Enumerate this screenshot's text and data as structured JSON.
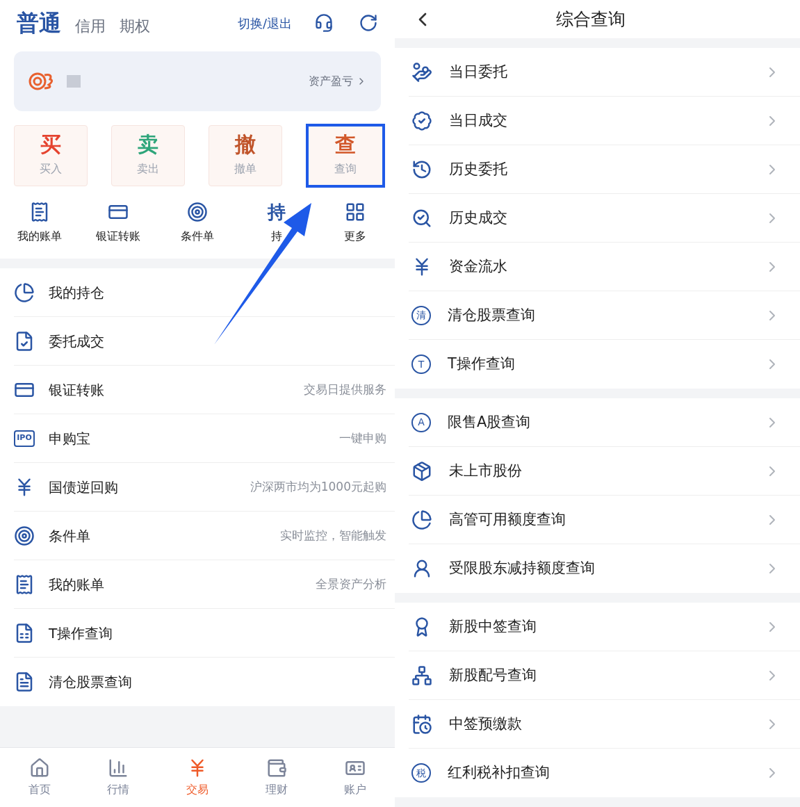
{
  "trade_screen": {
    "account_tabs": [
      {
        "label": "普通",
        "selected": true
      },
      {
        "label": "信用",
        "selected": false
      },
      {
        "label": "期权",
        "selected": false
      }
    ],
    "switch_link": "切换/退出",
    "account_card": {
      "link": "资产盈亏"
    },
    "trade_buttons": [
      {
        "glyph": "买",
        "label": "买入",
        "color": "#e5432f",
        "annotated": false
      },
      {
        "glyph": "卖",
        "label": "卖出",
        "color": "#2ea57a",
        "annotated": false
      },
      {
        "glyph": "撤",
        "label": "撤单",
        "color": "#c0542a",
        "annotated": false
      },
      {
        "glyph": "查",
        "label": "查询",
        "color": "#d2582a",
        "annotated": true
      }
    ],
    "shortcuts": [
      {
        "kind": "icon",
        "label": "我的账单"
      },
      {
        "kind": "icon",
        "label": "银证转账"
      },
      {
        "kind": "icon",
        "label": "条件单"
      },
      {
        "kind": "glyph",
        "glyph": "持",
        "label": "持"
      },
      {
        "kind": "icon",
        "label": "更多"
      }
    ],
    "menu": [
      {
        "label": "我的持仓"
      },
      {
        "label": "委托成交"
      },
      {
        "label": "银证转账",
        "hint": "交易日提供服务"
      },
      {
        "label": "申购宝",
        "badge": "IPO",
        "hint": "一键申购"
      },
      {
        "label": "国债逆回购",
        "hint": "沪深两市均为1000元起购"
      },
      {
        "label": "条件单",
        "hint": "实时监控，智能触发"
      },
      {
        "label": "我的账单",
        "hint": "全景资产分析"
      },
      {
        "label": "T操作查询"
      },
      {
        "label": "清仓股票查询"
      }
    ],
    "bottom_nav": [
      {
        "label": "首页",
        "selected": false
      },
      {
        "label": "行情",
        "selected": false
      },
      {
        "label": "交易",
        "selected": true
      },
      {
        "label": "理财",
        "selected": false
      },
      {
        "label": "账户",
        "selected": false
      }
    ]
  },
  "query_screen": {
    "title": "综合查询",
    "groups": [
      [
        {
          "kind": "icon",
          "label": "当日委托"
        },
        {
          "kind": "icon",
          "label": "当日成交"
        },
        {
          "kind": "icon",
          "label": "历史委托"
        },
        {
          "kind": "icon",
          "label": "历史成交"
        },
        {
          "kind": "icon",
          "label": "资金流水"
        },
        {
          "kind": "glyph",
          "glyph": "清",
          "label": "清仓股票查询"
        },
        {
          "kind": "glyph",
          "glyph": "T",
          "label": "T操作查询"
        }
      ],
      [
        {
          "kind": "glyph",
          "glyph": "A",
          "label": "限售A股查询"
        },
        {
          "kind": "icon",
          "label": "未上市股份"
        },
        {
          "kind": "icon",
          "label": "高管可用额度查询"
        },
        {
          "kind": "icon",
          "label": "受限股东减持额度查询"
        }
      ],
      [
        {
          "kind": "icon",
          "label": "新股中签查询"
        },
        {
          "kind": "icon",
          "label": "新股配号查询"
        },
        {
          "kind": "icon",
          "label": "中签预缴款"
        },
        {
          "kind": "glyph",
          "glyph": "税",
          "label": "红利税补扣查询"
        }
      ]
    ]
  }
}
